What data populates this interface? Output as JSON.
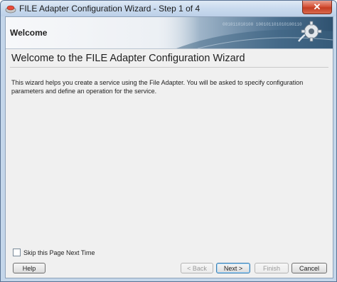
{
  "window": {
    "title": "FILE Adapter Configuration Wizard - Step 1 of 4",
    "close_symbol": "✕",
    "icon": "wizard-app-icon"
  },
  "header": {
    "title": "Welcome",
    "banner_binary": "001011010100 100101101010100110",
    "banner_icon": "gear-plug-icon"
  },
  "main": {
    "subtitle": "Welcome to the FILE Adapter Configuration Wizard",
    "description": "This wizard helps you create a service using the File Adapter. You will be asked to specify configuration parameters and define an operation for the service."
  },
  "footer": {
    "skip_label": "Skip this Page Next Time",
    "skip_checked": false,
    "help_label": "Help",
    "back_label": "< Back",
    "next_label": "Next >",
    "finish_label": "Finish",
    "cancel_label": "Cancel"
  },
  "colors": {
    "accent": "#3c7fb1",
    "close": "#c43c22",
    "banner": "#4a6e8e"
  }
}
